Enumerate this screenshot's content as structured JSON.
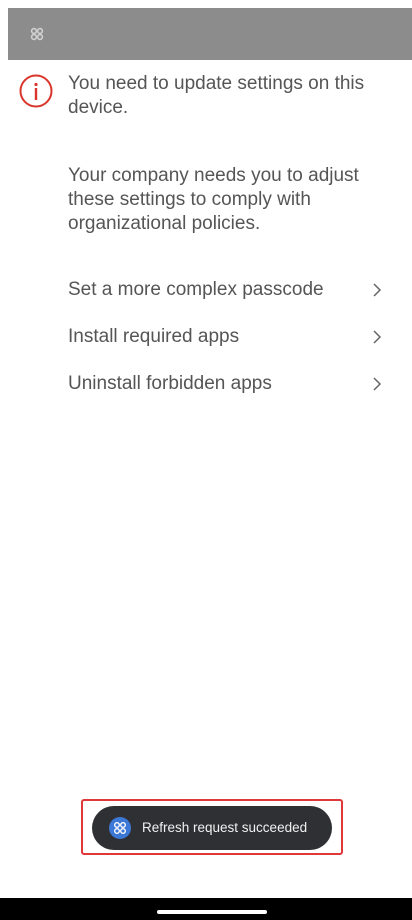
{
  "header": {
    "logo_icon": "company-logo-icon"
  },
  "alert": {
    "icon": "info-circle-icon",
    "icon_color": "#d9352b",
    "title": "You need to update settings on this device.",
    "description": "Your company needs you to adjust these settings to comply with organizational policies."
  },
  "settings": {
    "items": [
      {
        "label": "Set a more complex passcode",
        "icon": "chevron-right-icon"
      },
      {
        "label": "Install required apps",
        "icon": "chevron-right-icon"
      },
      {
        "label": "Uninstall forbidden apps",
        "icon": "chevron-right-icon"
      }
    ]
  },
  "toast": {
    "icon": "company-portal-icon",
    "text": "Refresh request succeeded",
    "highlight_color": "#e0383a"
  },
  "colors": {
    "status_bar": "#8c8c8c",
    "text": "#555555",
    "toast_background": "#2f3033",
    "toast_icon_background": "#3b78d8"
  }
}
